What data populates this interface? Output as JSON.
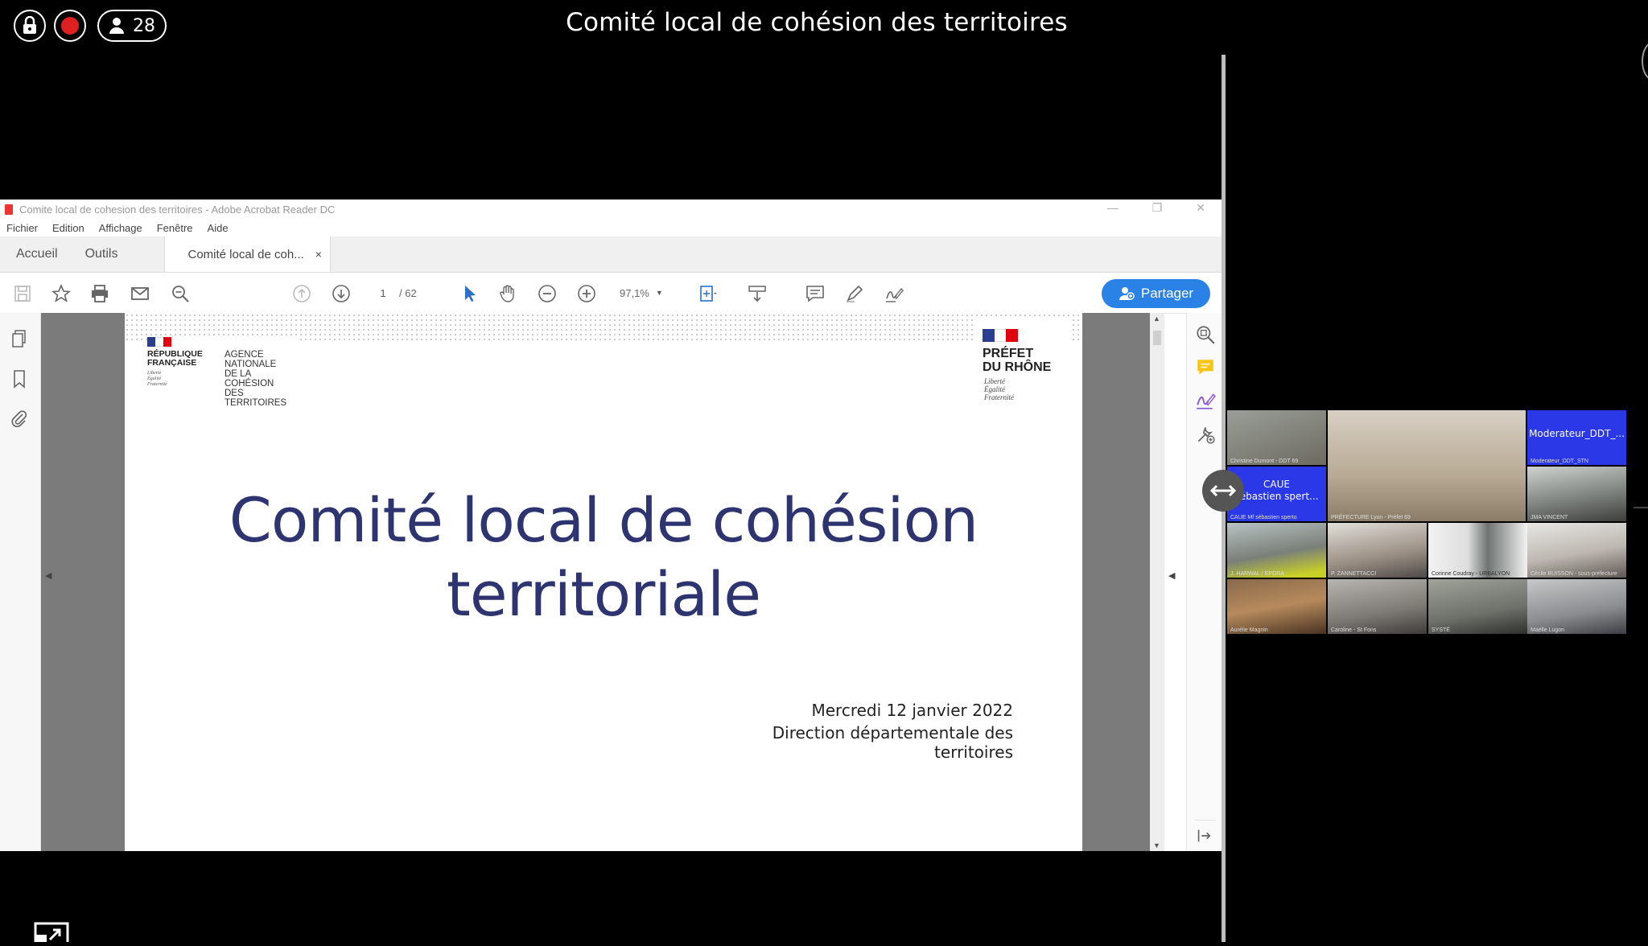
{
  "meeting": {
    "title": "Comité local de cohésion des territoires",
    "participant_count": "28"
  },
  "acrobat": {
    "window_title": "Comite local de cohesion des territoires - Adobe Acrobat Reader DC",
    "menu": [
      "Fichier",
      "Edition",
      "Affichage",
      "Fenêtre",
      "Aide"
    ],
    "tabs": {
      "home": "Accueil",
      "tools": "Outils",
      "document": "Comité local de coh...",
      "close": "×"
    },
    "page_current": "1",
    "page_total": "/ 62",
    "zoom": "97,1%",
    "share_label": "Partager",
    "accent_color": "#2b82e6"
  },
  "slide": {
    "rf_logo": [
      "RÉPUBLIQUE",
      "FRANÇAISE"
    ],
    "rf_motto": [
      "Liberté",
      "Égalité",
      "Fraternité"
    ],
    "anct": [
      "AGENCE",
      "NATIONALE",
      "DE LA COHÉSION",
      "DES TERRITOIRES"
    ],
    "prefet": [
      "PRÉFET",
      "DU RHÔNE"
    ],
    "prefet_motto": [
      "Liberté",
      "Égalité",
      "Fraternité"
    ],
    "title_line1": "Comité local de cohésion",
    "title_line2": "territoriale",
    "date": "Mercredi 12 janvier 2022",
    "direction": "Direction départementale des territoires",
    "title_color": "#2e3470"
  },
  "participants": {
    "moderator_label": "Moderateur_DDT_...",
    "moderator_sub": "Moderateur_DDT_STN",
    "caue_line1": "CAUE",
    "caue_line2": "sébastien spert...",
    "caue_sub": "CAUE Mf sébastien sperto",
    "names": [
      "Christine Dumont - DDT 69",
      "PRÉFECTURE Lyon - Préfet 69",
      "JMA VINCENT",
      "J. HARWAL / EPORA",
      "P. ZANNETTACCI",
      "Corinne Coudray - URBALYON",
      "Cécile BUISSON - sous-préfecture",
      "Aurélie Magnin",
      "Caroline - St Fons",
      "SYSTÉ",
      "Maëlle Lugon"
    ],
    "tile_color": "#2b38e8"
  }
}
